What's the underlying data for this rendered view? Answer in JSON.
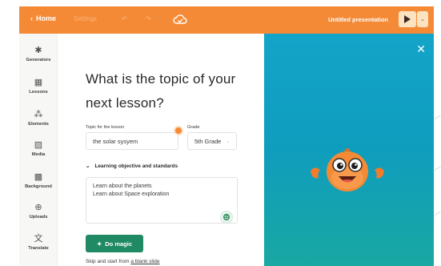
{
  "topbar": {
    "home_label": "Home",
    "ghost_items": [
      "Settings",
      "↶",
      "↷"
    ],
    "presentation_title": "Untitled presentation",
    "play_icon": "play-icon",
    "dropdown_icon": "chevron-down-icon",
    "accent_color": "#f58a36"
  },
  "sidebar": {
    "items": [
      {
        "label": "Generators",
        "icon": "wand-icon"
      },
      {
        "label": "Lessons",
        "icon": "grid-icon"
      },
      {
        "label": "Elements",
        "icon": "shapes-icon"
      },
      {
        "label": "Media",
        "icon": "image-icon"
      },
      {
        "label": "Background",
        "icon": "background-icon"
      },
      {
        "label": "Uploads",
        "icon": "upload-icon"
      },
      {
        "label": "Translate",
        "icon": "translate-icon"
      }
    ]
  },
  "main": {
    "heading": "What is the topic of your next lesson?",
    "topic_label": "Topic for the lesson",
    "topic_value": "the solar sysyem",
    "grade_label": "Grade",
    "grade_value": "5th Grade",
    "objectives_toggle": "Learning objective and standards",
    "objectives_lines": [
      "Learn about the planets",
      "Learn about Space exploration"
    ],
    "magic_button": "Do magic",
    "skip_text": "Skip and start from ",
    "skip_link": "a blank slide",
    "button_color": "#1f8a64"
  },
  "art": {
    "close_icon": "close-icon",
    "mascot": "mascot-character",
    "background_color": "#13a4c9"
  }
}
